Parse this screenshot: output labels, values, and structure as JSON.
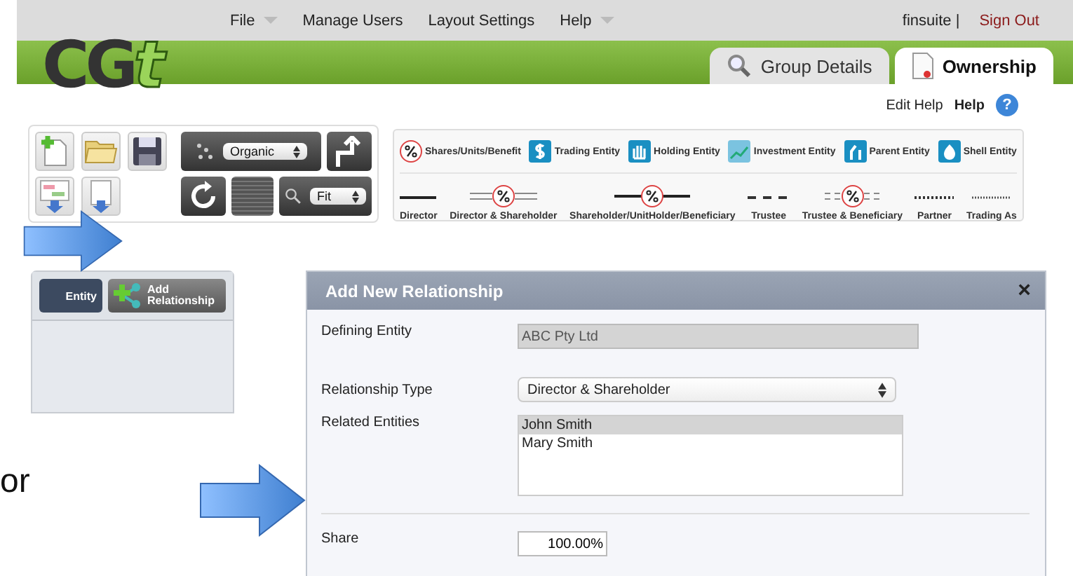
{
  "menu": {
    "items": [
      {
        "label": "File",
        "dropdown": true
      },
      {
        "label": "Manage Users",
        "dropdown": false
      },
      {
        "label": "Layout Settings",
        "dropdown": false
      },
      {
        "label": "Help",
        "dropdown": true
      }
    ],
    "user": "finsuite |",
    "sign_out": "Sign Out"
  },
  "logo": {
    "letters": "CG",
    "accent": "t"
  },
  "tabs": [
    {
      "label": "Group Details",
      "kind": "search",
      "selected": false
    },
    {
      "label": "Ownership",
      "kind": "document",
      "selected": true
    }
  ],
  "help_links": {
    "edit": "Edit Help",
    "help": "Help",
    "help_icon": "?"
  },
  "toolbar": {
    "layout_select": "Organic",
    "zoom_select": "Fit"
  },
  "legend": {
    "entities": [
      {
        "label": "Shares/Units/Benefit",
        "kind": "percent"
      },
      {
        "label": "Trading Entity",
        "kind": "dollar"
      },
      {
        "label": "Holding Entity",
        "kind": "hand"
      },
      {
        "label": "Investment Entity",
        "kind": "chart"
      },
      {
        "label": "Parent Entity",
        "kind": "parent"
      },
      {
        "label": "Shell Entity",
        "kind": "shell"
      }
    ],
    "lines": [
      {
        "label": "Director",
        "kind": "solid"
      },
      {
        "label": "Director & Shareholder",
        "kind": "double-percent"
      },
      {
        "label": "Shareholder/UnitHolder/Beneficiary",
        "kind": "solid-percent"
      },
      {
        "label": "Trustee",
        "kind": "dashed"
      },
      {
        "label": "Trustee & Beneficiary",
        "kind": "equals-percent"
      },
      {
        "label": "Partner",
        "kind": "dotted"
      },
      {
        "label": "Trading As",
        "kind": "fine-dotted"
      }
    ]
  },
  "side_panel": {
    "tabs": [
      {
        "label": "Entity",
        "kind": "entity"
      },
      {
        "label": "Add Relationship",
        "kind": "relationship"
      }
    ]
  },
  "or_text": "or",
  "dialog": {
    "title": "Add New Relationship",
    "close": "×",
    "defining_entity": {
      "label": "Defining Entity",
      "value": "ABC Pty Ltd",
      "disabled": true
    },
    "relationship_type": {
      "label": "Relationship Type",
      "value": "Director & Shareholder"
    },
    "related_entities": {
      "label": "Related Entities",
      "options": [
        {
          "label": "John Smith",
          "selected": true
        },
        {
          "label": "Mary Smith",
          "selected": false
        }
      ]
    },
    "share": {
      "label": "Share",
      "value": "100.00%"
    }
  }
}
